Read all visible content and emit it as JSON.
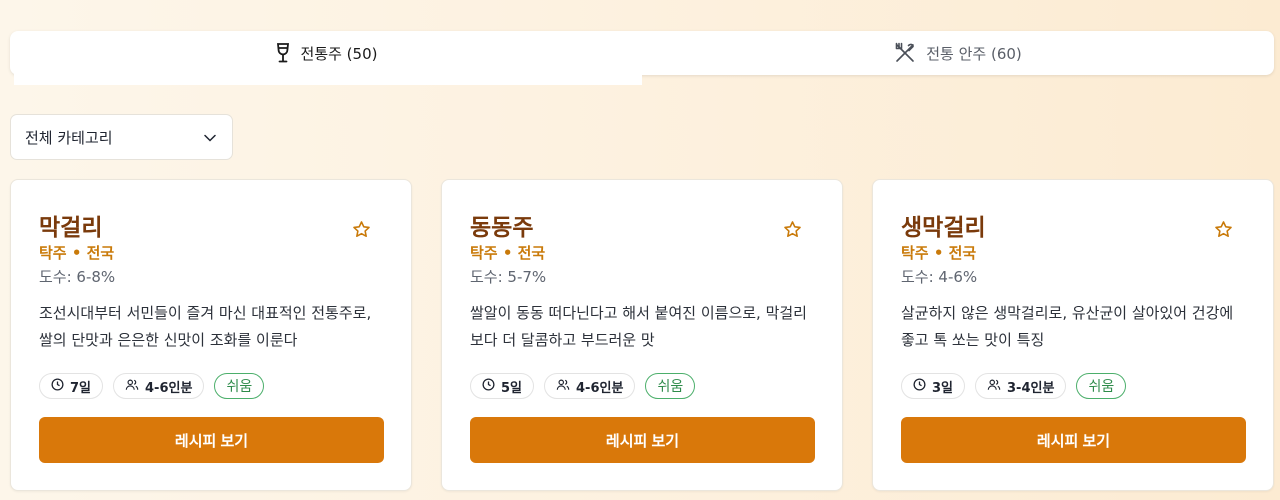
{
  "tabs": [
    {
      "label": "전통주 (50)",
      "icon": "wine-glass-icon",
      "active": true
    },
    {
      "label": "전통 안주 (60)",
      "icon": "utensils-crossed-icon",
      "active": false
    }
  ],
  "filter": {
    "selected": "전체 카테고리",
    "icon": "chevron-down-icon"
  },
  "colors": {
    "accent": "#d9780a",
    "title": "#7a3a0b",
    "subtitle": "#c97a0a",
    "level": "#2e8b4a"
  },
  "cards": [
    {
      "title": "막걸리",
      "subtitle": "탁주 • 전국",
      "abv": "도수: 6-8%",
      "description": "조선시대부터 서민들이 즐겨 마신 대표적인 전통주로, 쌀의 단맛과 은은한 신맛이 조화를 이룬다",
      "days": "7일",
      "servings": "4-6인분",
      "difficulty": "쉬움",
      "button": "레시피 보기"
    },
    {
      "title": "동동주",
      "subtitle": "탁주 • 전국",
      "abv": "도수: 5-7%",
      "description": "쌀알이 동동 떠다닌다고 해서 붙여진 이름으로, 막걸리보다 더 달콤하고 부드러운 맛",
      "days": "5일",
      "servings": "4-6인분",
      "difficulty": "쉬움",
      "button": "레시피 보기"
    },
    {
      "title": "생막걸리",
      "subtitle": "탁주 • 전국",
      "abv": "도수: 4-6%",
      "description": "살균하지 않은 생막걸리로, 유산균이 살아있어 건강에 좋고 톡 쏘는 맛이 특징",
      "days": "3일",
      "servings": "3-4인분",
      "difficulty": "쉬움",
      "button": "레시피 보기"
    }
  ]
}
